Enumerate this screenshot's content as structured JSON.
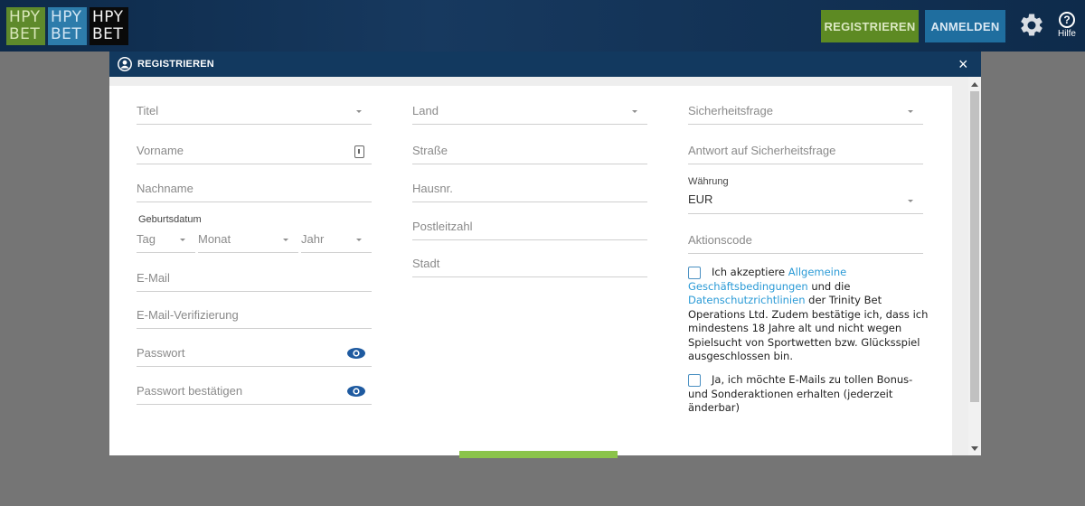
{
  "header": {
    "logos": [
      {
        "line1": "HPY",
        "line2": "BET"
      },
      {
        "line1": "HPY",
        "line2": "BET"
      },
      {
        "line1": "HPY",
        "line2": "BET"
      }
    ],
    "register_label": "REGISTRIEREN",
    "login_label": "ANMELDEN",
    "settings_icon": "gear-icon",
    "help_icon_glyph": "?",
    "help_label": "Hilfe"
  },
  "modal": {
    "title": "REGISTRIEREN",
    "close_glyph": "×",
    "col1": {
      "title_ph": "Titel",
      "firstname_ph": "Vorname",
      "lastname_ph": "Nachname",
      "birthdate_label": "Geburtsdatum",
      "day_ph": "Tag",
      "month_ph": "Monat",
      "year_ph": "Jahr",
      "email_ph": "E-Mail",
      "email_verify_ph": "E-Mail-Verifizierung",
      "password_ph": "Passwort",
      "password_confirm_ph": "Passwort bestätigen"
    },
    "col2": {
      "country_ph": "Land",
      "street_ph": "Straße",
      "housenr_ph": "Hausnr.",
      "zip_ph": "Postleitzahl",
      "city_ph": "Stadt"
    },
    "col3": {
      "security_question_ph": "Sicherheitsfrage",
      "security_answer_ph": "Antwort auf Sicherheitsfrage",
      "currency_label": "Währung",
      "currency_value": "EUR",
      "promo_code_ph": "Aktionscode",
      "terms": {
        "t1": "Ich akzeptiere ",
        "link1": "Allgemeine Geschäftsbedingungen",
        "t2": " und die ",
        "link2": "Datenschutzrichtlinien",
        "t3": " der Trinity Bet Operations Ltd. Zudem bestätige ich, dass ich mindestens 18 Jahre alt und nicht wegen Spielsucht von Sportwetten bzw. Glücksspiel ausgeschlossen bin."
      },
      "newsletter": "Ja, ich möchte E-Mails zu tollen Bonus- und Sonderaktionen erhalten (jederzeit änderbar)"
    }
  },
  "colors": {
    "header_bg": "#12395f",
    "register_green": "#5d8a23",
    "login_blue": "#1f6e9f",
    "link": "#2a9ad6",
    "submit_green": "#8bc34a"
  }
}
